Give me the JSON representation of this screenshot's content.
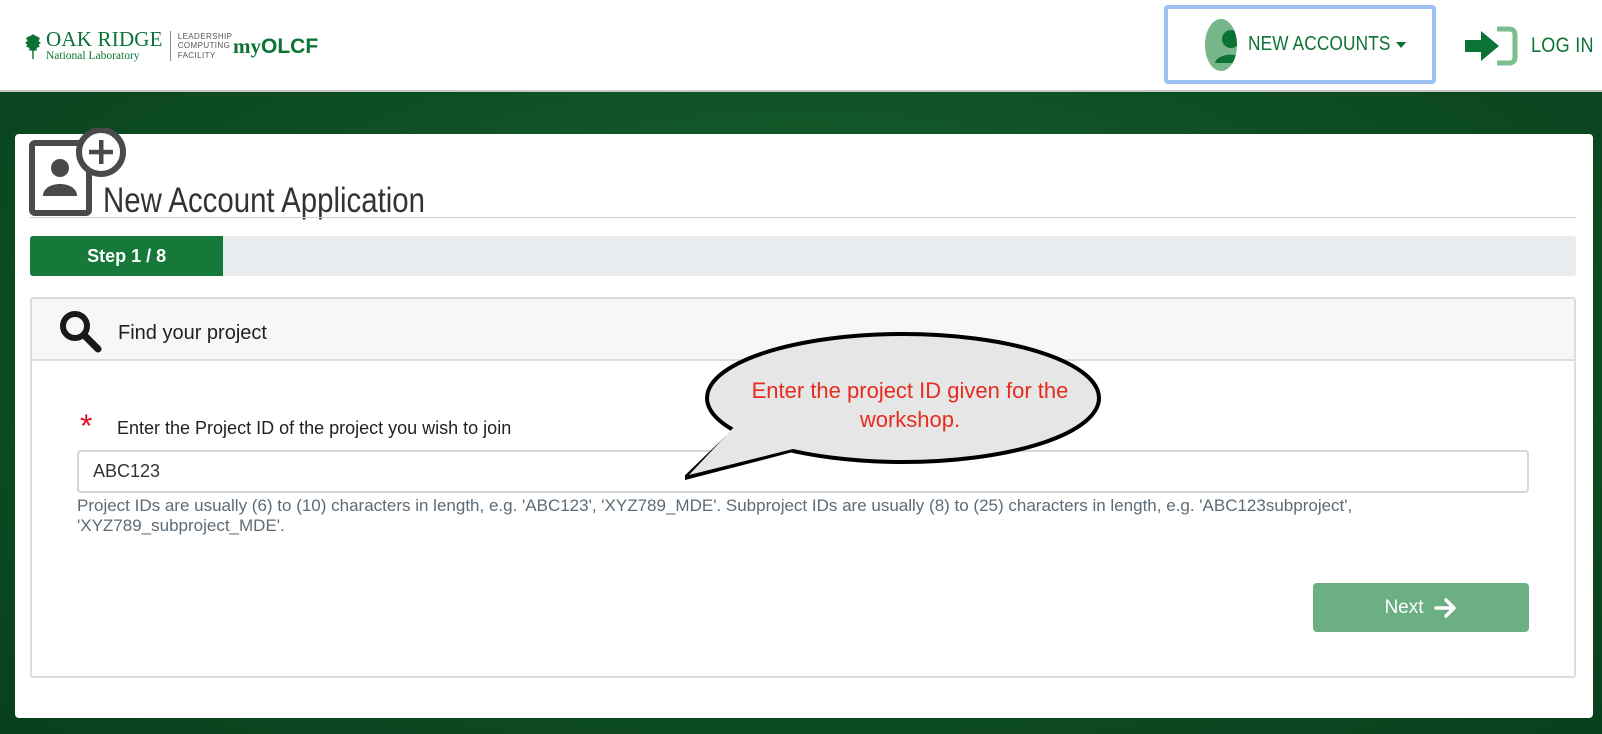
{
  "header": {
    "logo": {
      "main": "OAK RIDGE",
      "sub": "National Laboratory",
      "lcf_lines": [
        "LEADERSHIP",
        "COMPUTING",
        "FACILITY"
      ]
    },
    "brand": {
      "prefix": "my",
      "suffix": "OLCF"
    },
    "new_accounts_label": "NEW ACCOUNTS",
    "login_label": "LOG IN"
  },
  "page": {
    "title": "New Account Application",
    "progress": {
      "label": "Step 1 / 8",
      "current": 1,
      "total": 8
    }
  },
  "panel": {
    "title": "Find your project",
    "field_label": "Enter the Project ID of the project you wish to join",
    "required_marker": "*",
    "input_value": "ABC123",
    "help_text": "Project IDs are usually (6) to (10) characters in length, e.g. 'ABC123', 'XYZ789_MDE'. Subproject IDs are usually (8) to (25) characters in length, e.g. 'ABC123subproject', 'XYZ789_subproject_MDE'.",
    "next_label": "Next"
  },
  "callout": {
    "text": "Enter the project ID given for the workshop."
  },
  "colors": {
    "brand_green": "#0b7335",
    "progress_green": "#16793a",
    "next_button": "#6baf82",
    "callout_text": "#e62b1f",
    "focus_outline": "#9bc2f2"
  }
}
